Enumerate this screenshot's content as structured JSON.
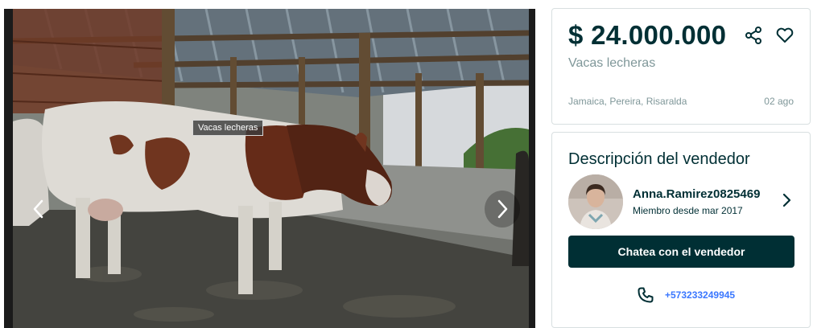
{
  "gallery": {
    "image_tooltip": "Vacas lecheras",
    "prev_icon": "chevron-left-icon",
    "next_icon": "chevron-right-icon"
  },
  "listing": {
    "price": "$ 24.000.000",
    "title": "Vacas lecheras",
    "location": "Jamaica, Pereira, Risaralda",
    "posted": "02 ago",
    "share_icon": "share-icon",
    "favorite_icon": "heart-icon"
  },
  "seller": {
    "heading": "Descripción del vendedor",
    "name": "Anna.Ramirez0825469",
    "member_since": "Miembro desde mar 2017",
    "chat_label": "Chatea con el vendedor",
    "phone": "+573233249945",
    "phone_icon": "phone-icon"
  },
  "colors": {
    "brand_dark": "#002f34",
    "muted_text": "#7f9799",
    "link_blue": "#3a77ff",
    "card_border": "#d8dfe0"
  }
}
